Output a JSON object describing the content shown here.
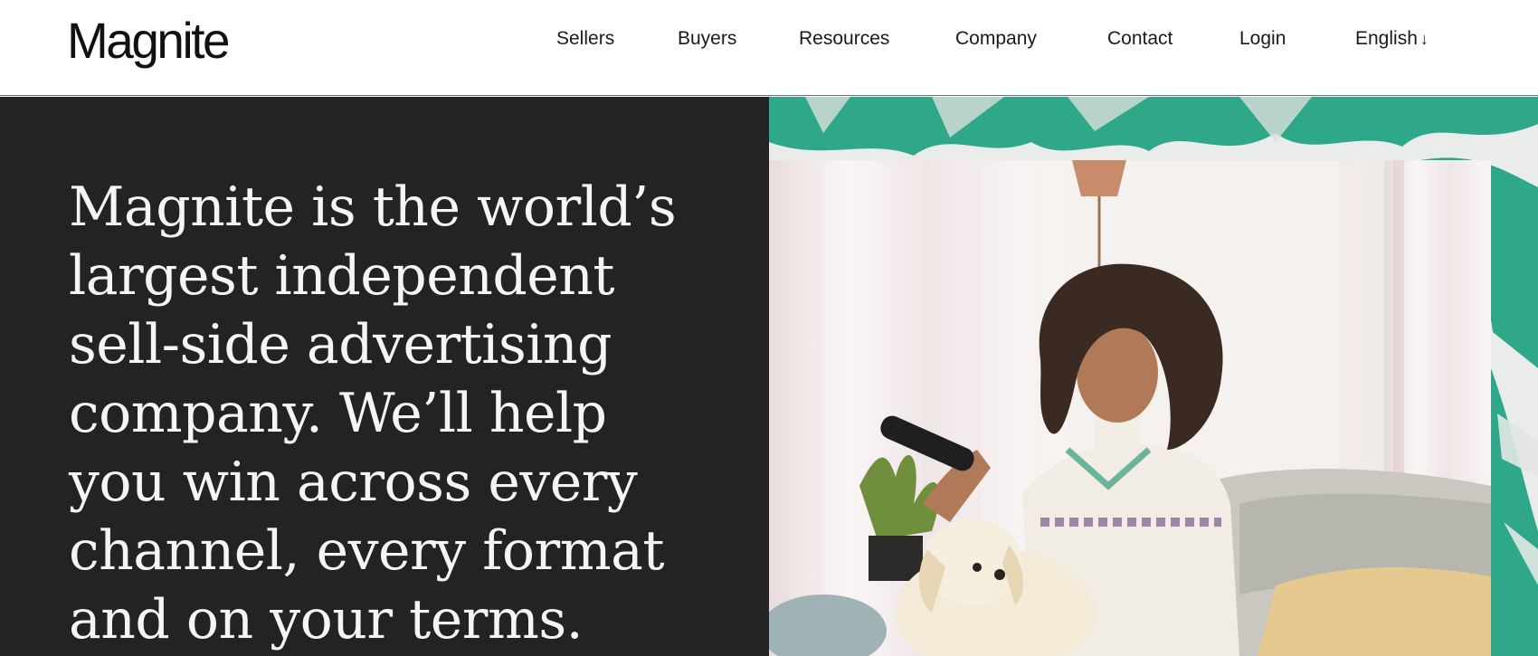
{
  "header": {
    "logo": "Magnite",
    "nav": [
      {
        "label": "Sellers"
      },
      {
        "label": "Buyers"
      },
      {
        "label": "Resources"
      },
      {
        "label": "Company"
      },
      {
        "label": "Contact"
      },
      {
        "label": "Login"
      },
      {
        "label": "English"
      }
    ]
  },
  "hero": {
    "headline": "Magnite is the world’s largest independent sell-side advertising company. We’ll help you win across every channel, every format and on your terms."
  },
  "colors": {
    "accent_teal": "#2fa88a",
    "hero_bg": "#232323"
  }
}
